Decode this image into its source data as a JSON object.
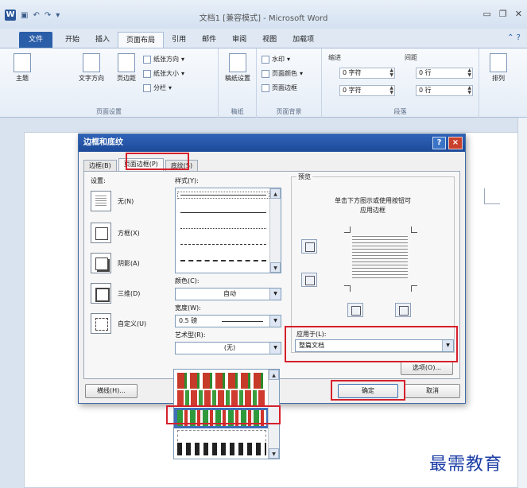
{
  "window": {
    "title": "文档1 [兼容模式] - Microsoft Word",
    "app_icon_letter": "W"
  },
  "ribbon_tabs": [
    "文件",
    "开始",
    "插入",
    "页面布局",
    "引用",
    "邮件",
    "审阅",
    "视图",
    "加载项"
  ],
  "ribbon": {
    "page_setup": {
      "label": "页面设置",
      "theme": "主题",
      "text_direction": "文字方向",
      "margins": "页边距",
      "orientation": "纸张方向",
      "size": "纸张大小",
      "columns": "分栏"
    },
    "draft": {
      "label": "稿纸",
      "button": "稿纸设置"
    },
    "page_background": {
      "label": "页面背景",
      "watermark": "水印",
      "page_color": "页面颜色",
      "page_borders": "页面边框"
    },
    "paragraph": {
      "label": "段落",
      "indent": "缩进",
      "spacing": "间距",
      "indent_left": "0 字符",
      "indent_right": "0 字符",
      "spacing_before": "0 行",
      "spacing_after": "0 行"
    },
    "arrange": {
      "label": "排列"
    }
  },
  "dialog": {
    "title": "边框和底纹",
    "help": "?",
    "close": "×",
    "tabs": [
      "边框(B)",
      "页面边框(P)",
      "底纹(S)"
    ],
    "settings_label": "设置:",
    "settings": [
      "无(N)",
      "方框(X)",
      "阴影(A)",
      "三维(D)",
      "自定义(U)"
    ],
    "style_label": "样式(Y):",
    "color_label": "颜色(C):",
    "color_value": "自动",
    "width_label": "宽度(W):",
    "width_value": "0.5 磅",
    "art_label": "艺术型(R):",
    "art_value": "(无)",
    "preview_label": "预览",
    "preview_hint_1": "单击下方图示或使用按钮可",
    "preview_hint_2": "应用边框",
    "apply_to_label": "应用于(L):",
    "apply_to_value": "整篇文档",
    "options_button": "选项(O)...",
    "horizontal_line_button": "横线(H)...",
    "ok_button": "确定",
    "cancel_button": "取消"
  },
  "watermark_text": "最需教育",
  "colors": {
    "file_tab": "#2a5ea8",
    "dialog_title": "#1d4a99",
    "highlight": "#d6202c",
    "watermark": "#1b3ea6"
  }
}
